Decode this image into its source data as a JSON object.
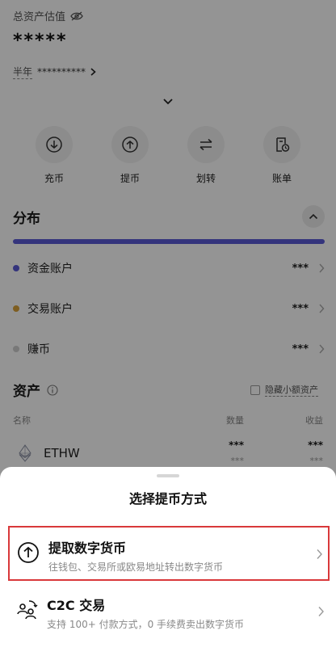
{
  "header": {
    "total_assets_label": "总资产估值",
    "hidden_value": "*****",
    "period_label": "半年",
    "period_value": "**********"
  },
  "actions": [
    {
      "label": "充币",
      "icon": "deposit-icon"
    },
    {
      "label": "提币",
      "icon": "withdraw-icon"
    },
    {
      "label": "划转",
      "icon": "transfer-icon"
    },
    {
      "label": "账单",
      "icon": "bill-icon"
    }
  ],
  "distribution": {
    "title": "分布",
    "accounts": [
      {
        "name": "资金账户",
        "value": "***",
        "color": "#5b5bd6"
      },
      {
        "name": "交易账户",
        "value": "***",
        "color": "#d9a33a"
      },
      {
        "name": "赚币",
        "value": "***",
        "color": "#cfcfcf"
      }
    ]
  },
  "assets": {
    "title": "资产",
    "hide_small_label": "隐藏小额资产",
    "columns": {
      "name": "名称",
      "quantity": "数量",
      "pnl": "收益"
    },
    "rows": [
      {
        "symbol": "ETHW",
        "quantity": "***",
        "quantity_sub": "***",
        "pnl": "***",
        "pnl_sub": "***"
      }
    ]
  },
  "sheet": {
    "title": "选择提币方式",
    "options": [
      {
        "title": "提取数字货币",
        "description": "往钱包、交易所或欧易地址转出数字货币",
        "icon": "withdraw-icon",
        "highlighted": true
      },
      {
        "title": "C2C 交易",
        "description": "支持 100+ 付款方式，0 手续费卖出数字货币",
        "icon": "c2c-icon",
        "highlighted": false
      }
    ]
  },
  "colors": {
    "accent": "#5b5bd6",
    "highlight_border": "#d9383a"
  }
}
